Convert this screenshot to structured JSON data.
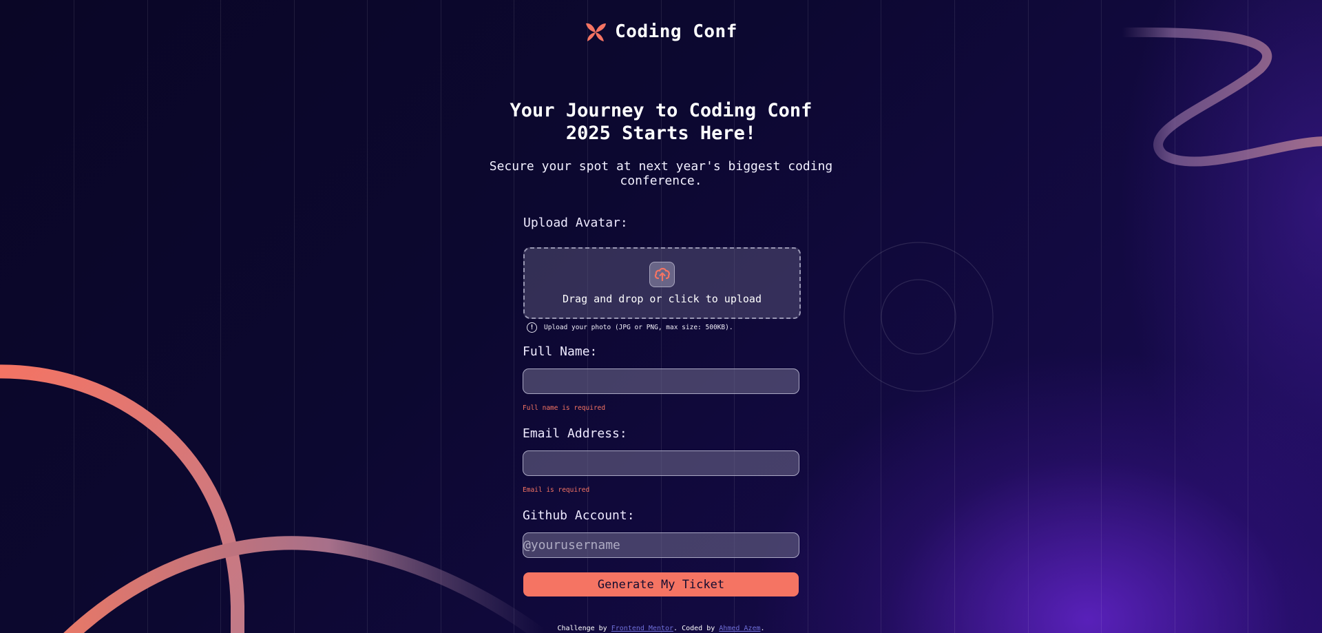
{
  "brand": {
    "name": "Coding Conf",
    "logo_icon": "conf-logo-icon",
    "accent_color": "#f57463"
  },
  "hero": {
    "title": "Your Journey to Coding Conf 2025 Starts Here!",
    "subtitle": "Secure your spot at next year's biggest coding conference."
  },
  "form": {
    "avatar": {
      "label": "Upload Avatar:",
      "dropzone_text": "Drag and drop or click to upload",
      "icon": "upload-cloud-icon",
      "hint": "Upload your photo (JPG or PNG, max size: 500KB)."
    },
    "full_name": {
      "label": "Full Name:",
      "value": "",
      "placeholder": "",
      "error": "Full name is required"
    },
    "email": {
      "label": "Email Address:",
      "value": "",
      "placeholder": "",
      "error": "Email is required"
    },
    "github": {
      "label": "Github Account:",
      "value": "",
      "placeholder": "@yourusername"
    },
    "submit_label": "Generate My Ticket"
  },
  "footer": {
    "prefix": "Challenge by ",
    "challenge_link": "Frontend Mentor",
    "middle": ". Coded by ",
    "author_link": "Ahmed Azem",
    "suffix": "."
  }
}
